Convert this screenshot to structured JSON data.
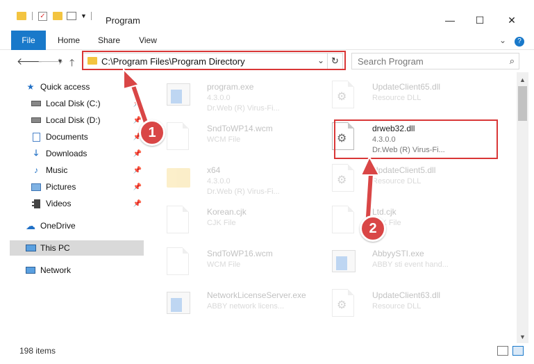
{
  "window": {
    "title": "Program",
    "minimize": "—",
    "maximize": "☐",
    "close": "✕",
    "collapse_ribbon": "⌄",
    "help": "?"
  },
  "ribbon": {
    "tabs": [
      "File",
      "Home",
      "Share",
      "View"
    ]
  },
  "address": {
    "path": "C:\\Program Files\\Program Directory",
    "search_placeholder": "Search Program"
  },
  "nav": {
    "items": [
      {
        "label": "Quick access",
        "icon": "star-icon",
        "pinned": false
      },
      {
        "label": "Local Disk (C:)",
        "icon": "drive-icon",
        "pinned": true
      },
      {
        "label": "Local Disk (D:)",
        "icon": "drive-icon",
        "pinned": true
      },
      {
        "label": "Documents",
        "icon": "documents-icon",
        "pinned": true
      },
      {
        "label": "Downloads",
        "icon": "download-icon",
        "pinned": true
      },
      {
        "label": "Music",
        "icon": "music-icon",
        "pinned": true
      },
      {
        "label": "Pictures",
        "icon": "pictures-icon",
        "pinned": true
      },
      {
        "label": "Videos",
        "icon": "videos-icon",
        "pinned": true
      },
      {
        "label": "OneDrive",
        "icon": "cloud-icon",
        "pinned": false
      },
      {
        "label": "This PC",
        "icon": "computer-icon",
        "pinned": false,
        "selected": true
      },
      {
        "label": "Network",
        "icon": "network-icon",
        "pinned": false
      }
    ]
  },
  "files": [
    {
      "name": "program.exe",
      "sub1": "4.3.0.0",
      "sub2": "Dr.Web (R) Virus-Fi...",
      "kind": "exe",
      "faded": true
    },
    {
      "name": "UpdateClient65.dll",
      "sub1": "Resource DLL",
      "sub2": "",
      "kind": "dll",
      "faded": true
    },
    {
      "name": "SndToWP14.wcm",
      "sub1": "WCM File",
      "sub2": "",
      "kind": "doc",
      "faded": true
    },
    {
      "name": "drweb32.dll",
      "sub1": "4.3.0.0",
      "sub2": "Dr.Web (R) Virus-Fi...",
      "kind": "dll",
      "faded": false
    },
    {
      "name": "x64",
      "sub1": "4.3.0.0",
      "sub2": "Dr.Web (R) Virus-Fi...",
      "kind": "folder",
      "faded": true
    },
    {
      "name": "UpdateClient5.dll",
      "sub1": "Resource DLL",
      "sub2": "",
      "kind": "dll",
      "faded": true
    },
    {
      "name": "Korean.cjk",
      "sub1": "CJK File",
      "sub2": "",
      "kind": "doc",
      "faded": true
    },
    {
      "name": "Ltd.cjk",
      "sub1": "CJK File",
      "sub2": "",
      "kind": "doc",
      "faded": true
    },
    {
      "name": "SndToWP16.wcm",
      "sub1": "WCM File",
      "sub2": "",
      "kind": "doc",
      "faded": true
    },
    {
      "name": "AbbyySTI.exe",
      "sub1": "ABBY sti event hand...",
      "sub2": "",
      "kind": "exe",
      "faded": true
    },
    {
      "name": "NetworkLicenseServer.exe",
      "sub1": "ABBY network licens...",
      "sub2": "",
      "kind": "exe",
      "faded": true
    },
    {
      "name": "UpdateClient63.dll",
      "sub1": "Resource DLL",
      "sub2": "",
      "kind": "dll",
      "faded": true
    }
  ],
  "badges": [
    "1",
    "2"
  ],
  "status": {
    "item_count": "198 items"
  }
}
